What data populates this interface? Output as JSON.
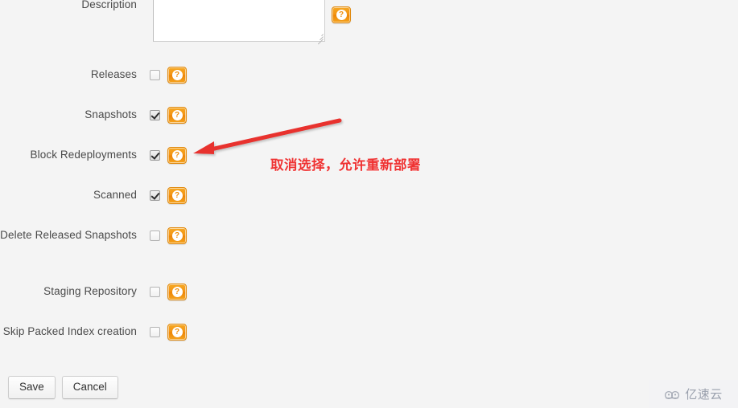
{
  "form": {
    "description_row": {
      "label": "Description",
      "textarea_value": "",
      "textarea_placeholder": "",
      "help_icon": "help-question-icon",
      "help_label": "?"
    },
    "rows": [
      {
        "label": "Releases",
        "checked": false,
        "help_label": "?",
        "help_icon": "help-question-icon",
        "name": "releases"
      },
      {
        "label": "Snapshots",
        "checked": true,
        "help_label": "?",
        "help_icon": "help-question-icon",
        "name": "snapshots"
      },
      {
        "label": "Block Redeployments",
        "checked": true,
        "help_label": "?",
        "help_icon": "help-question-icon",
        "name": "block-redeployments"
      },
      {
        "label": "Scanned",
        "checked": true,
        "help_label": "?",
        "help_icon": "help-question-icon",
        "name": "scanned"
      },
      {
        "label": "Delete Released Snapshots",
        "checked": false,
        "help_label": "?",
        "help_icon": "help-question-icon",
        "name": "delete-released-snapshots"
      },
      {
        "label": "Staging Repository",
        "checked": false,
        "help_label": "?",
        "help_icon": "help-question-icon",
        "name": "staging-repository"
      },
      {
        "label": "Skip Packed Index creation",
        "checked": false,
        "help_label": "?",
        "help_icon": "help-question-icon",
        "name": "skip-packed-index-creation"
      }
    ],
    "buttons": {
      "save": "Save",
      "cancel": "Cancel"
    }
  },
  "annotation": {
    "text": "取消选择，允许重新部署",
    "color": "#ef3232",
    "arrow_icon": "arrow-pointing-left-icon"
  },
  "watermark": {
    "text": "亿速云",
    "logo_icon": "cloud-logo-icon",
    "color": "#9aa0ad"
  },
  "colors": {
    "page_background": "#f4f4f4",
    "help_button_orange": "#f39313",
    "label_text": "#4a4a4a",
    "annotation_red": "#ef3232"
  }
}
